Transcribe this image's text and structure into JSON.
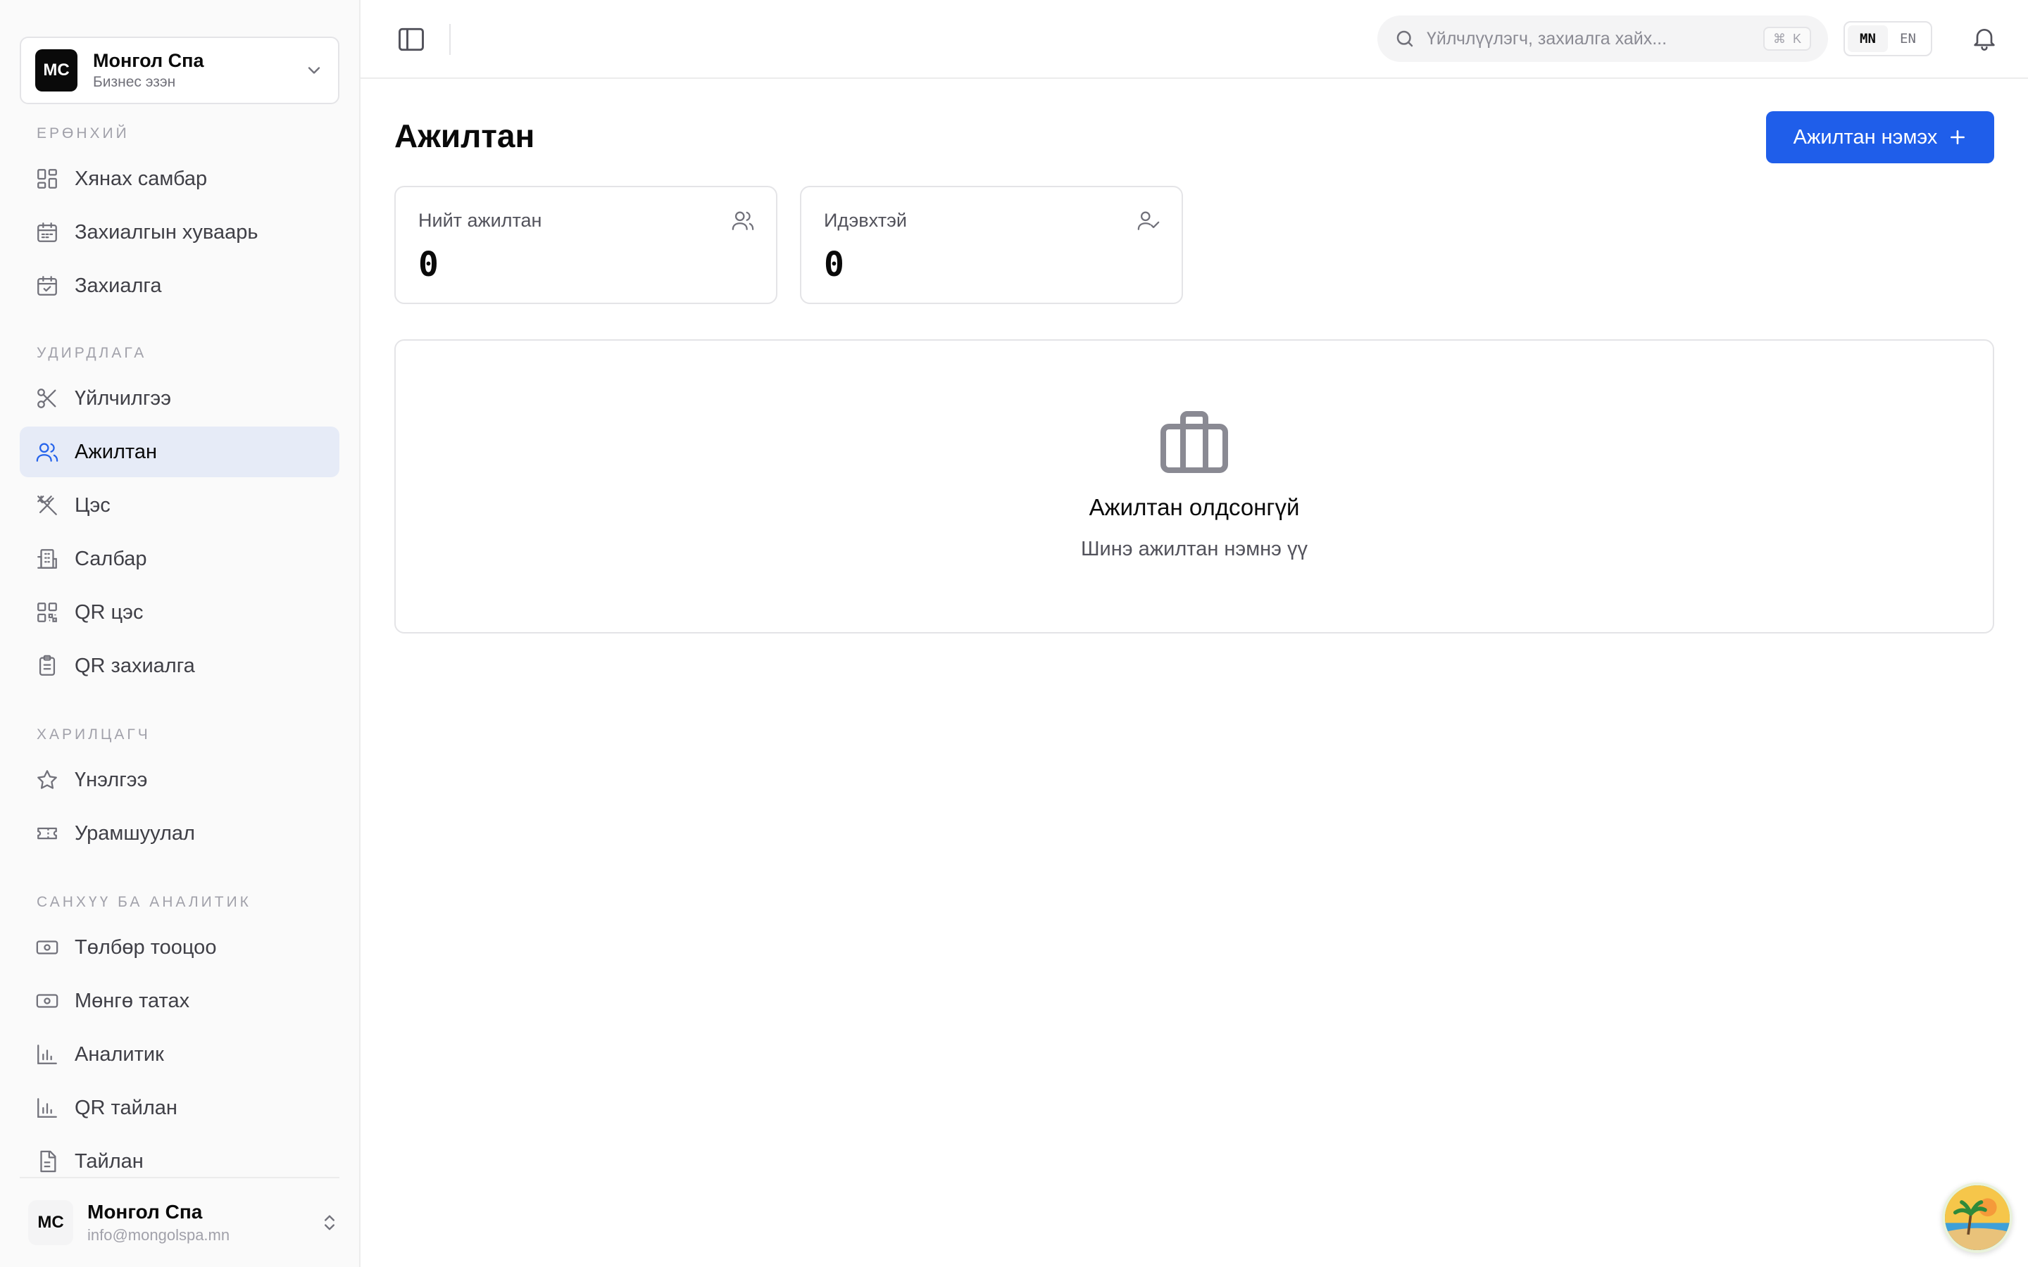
{
  "business": {
    "avatar": "МС",
    "name": "Монгол Спа",
    "role": "Бизнес эзэн"
  },
  "sections": {
    "general": "ЕРӨНХИЙ",
    "management": "УДИРДЛАГА",
    "customer": "ХАРИЛЦАГЧ",
    "finance": "САНХҮҮ БА АНАЛИТИК"
  },
  "nav": {
    "dashboard": "Хянах самбар",
    "schedule": "Захиалгын хуваарь",
    "bookings": "Захиалга",
    "services": "Үйлчилгээ",
    "staff": "Ажилтан",
    "menu": "Цэс",
    "branch": "Салбар",
    "qr_menu": "QR цэс",
    "qr_orders": "QR захиалга",
    "reviews": "Үнэлгээ",
    "promotions": "Урамшуулал",
    "payments": "Төлбөр тооцоо",
    "withdraw": "Мөнгө татах",
    "analytics": "Аналитик",
    "qr_report": "QR тайлан",
    "report": "Тайлан"
  },
  "active_nav": "staff",
  "footer": {
    "avatar": "МС",
    "name": "Монгол Спа",
    "email": "info@mongolspa.mn"
  },
  "topbar": {
    "search_placeholder": "Үйлчлүүлэгч, захиалга хайх...",
    "shortcut_mod": "⌘",
    "shortcut_key": "K",
    "lang_mn": "MN",
    "lang_en": "EN",
    "selected_lang": "MN"
  },
  "page": {
    "title": "Ажилтан",
    "add_button": "Ажилтан нэмэх"
  },
  "stats": {
    "total_label": "Нийт ажилтан",
    "total_value": "0",
    "active_label": "Идэвхтэй",
    "active_value": "0"
  },
  "empty_state": {
    "title": "Ажилтан олдсонгүй",
    "subtitle": "Шинэ ажилтан нэмнэ үү"
  },
  "colors": {
    "accent": "#1f5eea",
    "active_nav_bg": "#e6ebf7"
  }
}
